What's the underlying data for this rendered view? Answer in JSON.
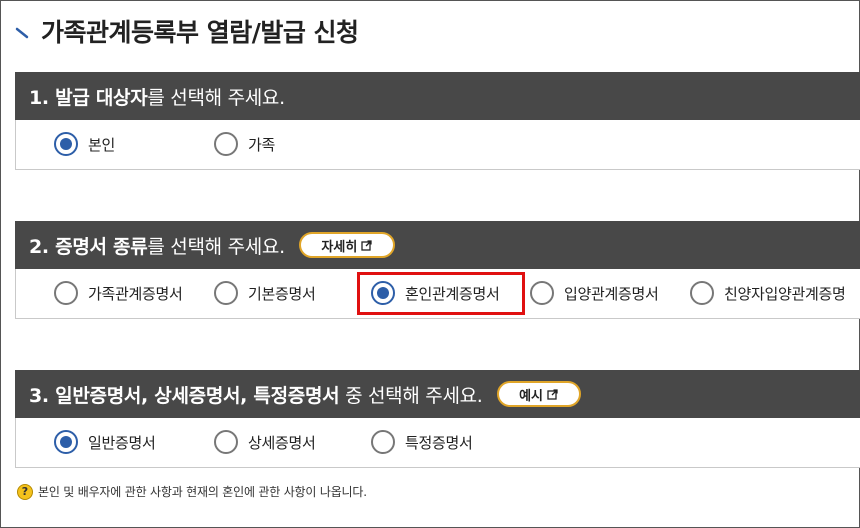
{
  "page": {
    "title": "가족관계등록부 열람/발급 신청"
  },
  "section1": {
    "heading_bold": "1. 발급 대상자",
    "heading_normal": "를 선택해 주세요.",
    "options": [
      {
        "label": "본인",
        "selected": true
      },
      {
        "label": "가족",
        "selected": false
      }
    ]
  },
  "section2": {
    "heading_bold": "2. 증명서 종류",
    "heading_normal": "를 선택해 주세요.",
    "detail_button": "자세히",
    "options": [
      {
        "label": "가족관계증명서",
        "selected": false
      },
      {
        "label": "기본증명서",
        "selected": false
      },
      {
        "label": "혼인관계증명서",
        "selected": true
      },
      {
        "label": "입양관계증명서",
        "selected": false
      },
      {
        "label": "친양자입양관계증명",
        "selected": false
      }
    ]
  },
  "section3": {
    "heading_bold": "3. 일반증명서, 상세증명서, 특정증명서",
    "heading_normal": " 중 선택해 주세요.",
    "example_button": "예시",
    "options": [
      {
        "label": "일반증명서",
        "selected": true
      },
      {
        "label": "상세증명서",
        "selected": false
      },
      {
        "label": "특정증명서",
        "selected": false
      }
    ]
  },
  "footnote": {
    "text": "본인 및 배우자에 관한 사항과 현재의 혼인에 관한 사항이 나옵니다."
  },
  "colors": {
    "selected_radio": "#2d5ea8",
    "header_bg": "#484848",
    "pill_border": "#e0a528",
    "highlight": "#e01010",
    "help_icon": "#f4c21c"
  }
}
